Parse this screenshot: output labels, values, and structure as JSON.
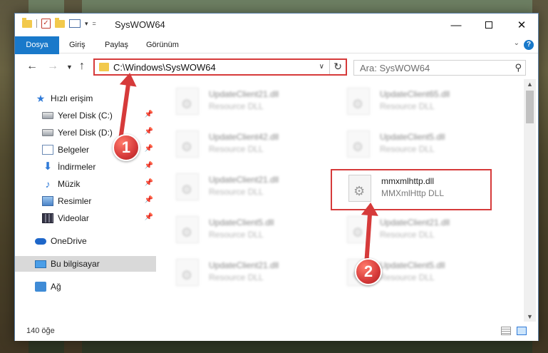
{
  "window": {
    "title": "SysWOW64"
  },
  "ribbon": {
    "tabs": [
      "Dosya",
      "Giriş",
      "Paylaş",
      "Görünüm"
    ]
  },
  "navbar": {
    "address": "C:\\Windows\\SysWOW64",
    "search_placeholder": "Ara: SysWOW64"
  },
  "sidebar": {
    "items": [
      {
        "label": "Hızlı erişim",
        "icon": "star-icon"
      },
      {
        "label": "Yerel Disk (C:)",
        "icon": "disk-icon",
        "pinned": true
      },
      {
        "label": "Yerel Disk (D:)",
        "icon": "disk-icon",
        "pinned": true
      },
      {
        "label": "Belgeler",
        "icon": "documents-icon",
        "pinned": true
      },
      {
        "label": "İndirmeler",
        "icon": "download-icon",
        "pinned": true
      },
      {
        "label": "Müzik",
        "icon": "music-icon",
        "pinned": true
      },
      {
        "label": "Resimler",
        "icon": "pictures-icon",
        "pinned": true
      },
      {
        "label": "Videolar",
        "icon": "videos-icon",
        "pinned": true
      },
      {
        "label": "OneDrive",
        "icon": "cloud-icon"
      },
      {
        "label": "Bu bilgisayar",
        "icon": "computer-icon",
        "selected": true
      },
      {
        "label": "Ağ",
        "icon": "network-icon"
      }
    ]
  },
  "files": [
    {
      "name": "UpdateClient21.dll",
      "desc": "Resource DLL",
      "blurred": true
    },
    {
      "name": "UpdateClient65.dll",
      "desc": "Resource DLL",
      "blurred": true
    },
    {
      "name": "UpdateClient42.dll",
      "desc": "Resource DLL",
      "blurred": true
    },
    {
      "name": "UpdateClient5.dll",
      "desc": "Resource DLL",
      "blurred": true
    },
    {
      "name": "UpdateClient21.dll",
      "desc": "Resource DLL",
      "blurred": true
    },
    {
      "name": "mmxmlhttp.dll",
      "desc": "MMXmlHttp DLL",
      "blurred": false
    },
    {
      "name": "UpdateClient5.dll",
      "desc": "Resource DLL",
      "blurred": true
    },
    {
      "name": "UpdateClient21.dll",
      "desc": "Resource DLL",
      "blurred": true
    },
    {
      "name": "UpdateClient21.dll",
      "desc": "Resource DLL",
      "blurred": true
    },
    {
      "name": "UpdateClient5.dll",
      "desc": "Resource DLL",
      "blurred": true
    }
  ],
  "status": {
    "item_count": "140 öğe"
  },
  "annotations": {
    "badge1": "1",
    "badge2": "2",
    "color": "#d63a3a"
  }
}
